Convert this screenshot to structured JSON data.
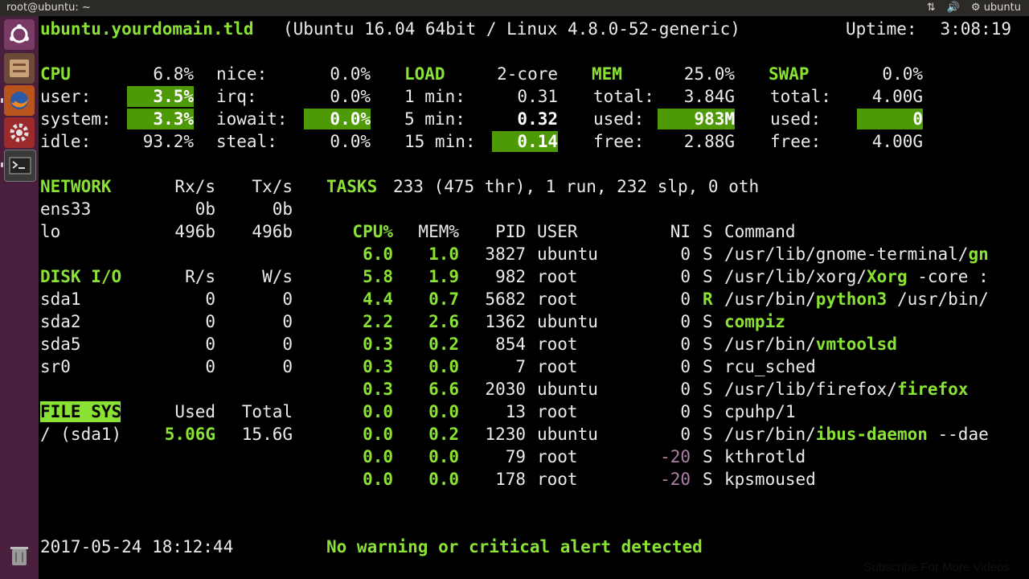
{
  "window": {
    "title": "root@ubuntu: ~",
    "user": "ubuntu"
  },
  "header": {
    "hostname": "ubuntu.yourdomain.tld",
    "os": "(Ubuntu 16.04 64bit / Linux 4.8.0-52-generic)",
    "uptime_label": "Uptime:",
    "uptime": "3:08:19"
  },
  "cpu": {
    "label": "CPU",
    "total": "6.8%",
    "rows": [
      {
        "k": "user:",
        "v": "3.5%"
      },
      {
        "k": "system:",
        "v": "3.3%"
      },
      {
        "k": "idle:",
        "v": "93.2%"
      }
    ],
    "rows2": [
      {
        "k": "nice:",
        "v": "0.0%"
      },
      {
        "k": "irq:",
        "v": "0.0%"
      },
      {
        "k": "iowait:",
        "v": "0.0%"
      },
      {
        "k": "steal:",
        "v": "0.0%"
      }
    ]
  },
  "load": {
    "label": "LOAD",
    "cores": "2-core",
    "rows": [
      {
        "k": "1 min:",
        "v": "0.31"
      },
      {
        "k": "5 min:",
        "v": "0.32"
      },
      {
        "k": "15 min:",
        "v": "0.14"
      }
    ]
  },
  "mem": {
    "label": "MEM",
    "pct": "25.0%",
    "rows": [
      {
        "k": "total:",
        "v": "3.84G"
      },
      {
        "k": "used:",
        "v": "983M"
      },
      {
        "k": "free:",
        "v": "2.88G"
      }
    ]
  },
  "swap": {
    "label": "SWAP",
    "pct": "0.0%",
    "rows": [
      {
        "k": "total:",
        "v": "4.00G"
      },
      {
        "k": "used:",
        "v": "0"
      },
      {
        "k": "free:",
        "v": "4.00G"
      }
    ]
  },
  "network": {
    "label": "NETWORK",
    "rx": "Rx/s",
    "tx": "Tx/s",
    "rows": [
      {
        "name": "ens33",
        "rx": "0b",
        "tx": "0b"
      },
      {
        "name": "lo",
        "rx": "496b",
        "tx": "496b"
      }
    ]
  },
  "disk": {
    "label": "DISK I/O",
    "r": "R/s",
    "w": "W/s",
    "rows": [
      {
        "name": "sda1",
        "r": "0",
        "w": "0"
      },
      {
        "name": "sda2",
        "r": "0",
        "w": "0"
      },
      {
        "name": "sda5",
        "r": "0",
        "w": "0"
      },
      {
        "name": "sr0",
        "r": "0",
        "w": "0"
      }
    ]
  },
  "fs": {
    "label": "FILE SYS",
    "used": "Used",
    "total": "Total",
    "rows": [
      {
        "name": "/ (sda1)",
        "used": "5.06G",
        "total": "15.6G"
      }
    ]
  },
  "tasks": {
    "label": "TASKS",
    "summary": "233 (475 thr), 1 run, 232 slp, 0 oth"
  },
  "procs": {
    "headers": {
      "cpu": "CPU%",
      "mem": "MEM%",
      "pid": "PID",
      "user": "USER",
      "ni": "NI",
      "s": "S",
      "cmd": "Command"
    },
    "rows": [
      {
        "cpu": "6.0",
        "mem": "1.0",
        "pid": "3827",
        "user": "ubuntu",
        "ni": "0",
        "s": "S",
        "p1": "/usr/lib/gnome-terminal/",
        "b": "gn",
        "p2": ""
      },
      {
        "cpu": "5.8",
        "mem": "1.9",
        "pid": "982",
        "user": "root",
        "ni": "0",
        "s": "S",
        "p1": "/usr/lib/xorg/",
        "b": "Xorg",
        "p2": " -core :"
      },
      {
        "cpu": "4.4",
        "mem": "0.7",
        "pid": "5682",
        "user": "root",
        "ni": "0",
        "s": "R",
        "p1": "/usr/bin/",
        "b": "python3",
        "p2": " /usr/bin/"
      },
      {
        "cpu": "2.2",
        "mem": "2.6",
        "pid": "1362",
        "user": "ubuntu",
        "ni": "0",
        "s": "S",
        "p1": "",
        "b": "compiz",
        "p2": ""
      },
      {
        "cpu": "0.3",
        "mem": "0.2",
        "pid": "854",
        "user": "root",
        "ni": "0",
        "s": "S",
        "p1": "/usr/bin/",
        "b": "vmtoolsd",
        "p2": ""
      },
      {
        "cpu": "0.3",
        "mem": "0.0",
        "pid": "7",
        "user": "root",
        "ni": "0",
        "s": "S",
        "p1": "rcu_sched",
        "b": "",
        "p2": ""
      },
      {
        "cpu": "0.3",
        "mem": "6.6",
        "pid": "2030",
        "user": "ubuntu",
        "ni": "0",
        "s": "S",
        "p1": "/usr/lib/firefox/",
        "b": "firefox",
        "p2": ""
      },
      {
        "cpu": "0.0",
        "mem": "0.0",
        "pid": "13",
        "user": "root",
        "ni": "0",
        "s": "S",
        "p1": "cpuhp/1",
        "b": "",
        "p2": ""
      },
      {
        "cpu": "0.0",
        "mem": "0.2",
        "pid": "1230",
        "user": "ubuntu",
        "ni": "0",
        "s": "S",
        "p1": "/usr/bin/",
        "b": "ibus-daemon",
        "p2": " --dae"
      },
      {
        "cpu": "0.0",
        "mem": "0.0",
        "pid": "79",
        "user": "root",
        "ni": "-20",
        "s": "S",
        "p1": "kthrotld",
        "b": "",
        "p2": ""
      },
      {
        "cpu": "0.0",
        "mem": "0.0",
        "pid": "178",
        "user": "root",
        "ni": "-20",
        "s": "S",
        "p1": "kpsmoused",
        "b": "",
        "p2": ""
      }
    ]
  },
  "footer": {
    "datetime": "2017-05-24 18:12:44",
    "alert": "No warning or critical alert detected"
  },
  "watermark": "Subscribe For More Videos",
  "colors": {
    "green": "#8ae234",
    "green_bg": "#4e9a06",
    "launcher": "#4a1e3d",
    "topbar": "#2b2a27",
    "nice_neg": "#ad7fa8"
  }
}
